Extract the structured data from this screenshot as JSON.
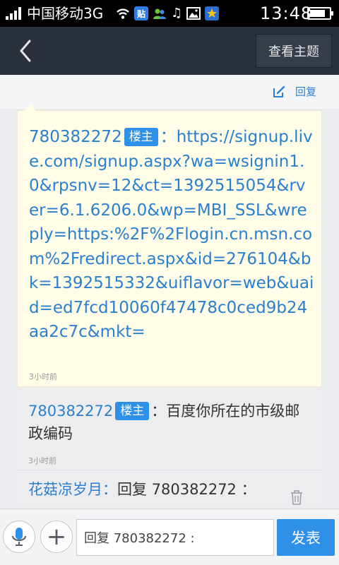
{
  "status_bar": {
    "carrier": "中国移动3G",
    "time": "13:48",
    "icons": [
      "signal-icon",
      "wifi-icon",
      "tieba-icon",
      "contacts-icon",
      "music-icon",
      "image-icon",
      "star-icon",
      "battery-icon"
    ],
    "tieba_badge": "贴",
    "battery_level": 0.8
  },
  "nav": {
    "back_icon": "chevron-left-icon",
    "topic_button": "查看主题"
  },
  "actions": {
    "edit_icon": "edit-icon",
    "reply_label": "回复"
  },
  "post": {
    "author": "780382272",
    "badge": "楼主",
    "separator": "：",
    "content": "https://signup.live.com/signup.aspx?wa=wsignin1.0&rpsnv=12&ct=1392515054&rver=6.1.6206.0&wp=MBI_SSL&wreply=https:%2F%2Flogin.cn.msn.com%2Fredirect.aspx&id=276104&bk=1392515332&uiflavor=web&uaid=ed7fcd10060f47478c0ced9b24aa2c7c&mkt=",
    "time": "3小时前"
  },
  "comments": [
    {
      "author": "780382272",
      "badge": "楼主",
      "separator": "：",
      "text": "百度你所在的市级邮政编码",
      "time": "3小时前"
    },
    {
      "author": "花菇凉岁月",
      "separator": "：",
      "text": "回复 780382272 ："
    }
  ],
  "bottom_bar": {
    "mic_icon": "microphone-icon",
    "plus_icon": "plus-icon",
    "plus_glyph": "+",
    "input_value": "回复 780382272 :",
    "publish_label": "发表"
  },
  "colors": {
    "accent": "#2f90e8",
    "link": "#2a7fd0",
    "nav_bg": "#2a313d",
    "post_bg": "#fffde7"
  }
}
